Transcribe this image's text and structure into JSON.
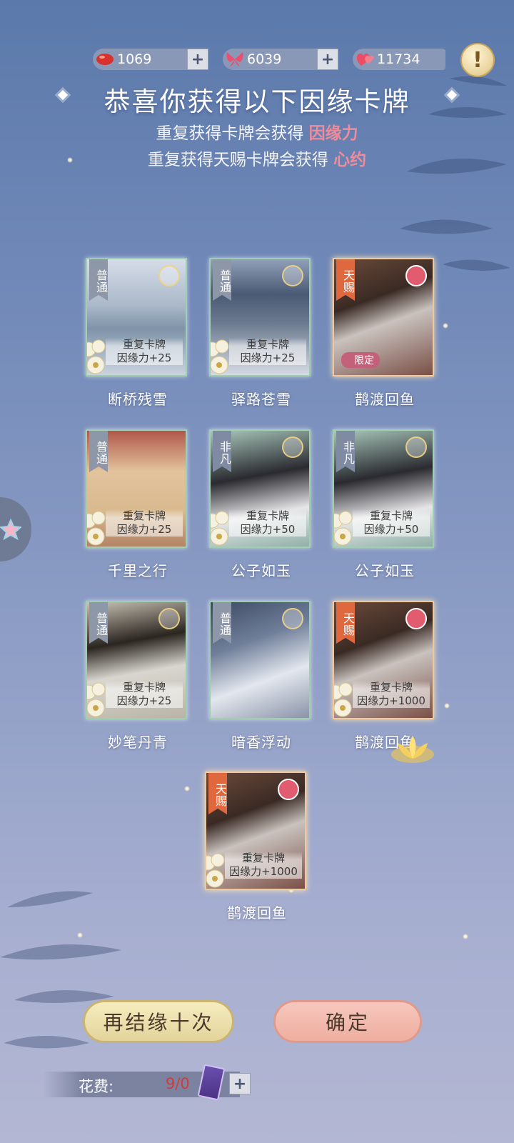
{
  "resources": [
    {
      "name": "red-bean",
      "value": "1069",
      "icon": "red-bean-icon",
      "color": "#d8322e"
    },
    {
      "name": "butterfly",
      "value": "6039",
      "icon": "butterfly-icon",
      "color": "#e94f6f"
    },
    {
      "name": "hearts",
      "value": "11734",
      "icon": "hearts-icon",
      "color": "#ea4d65"
    }
  ],
  "alert_glyph": "!",
  "header": {
    "title": "恭喜你获得以下因缘卡牌",
    "line1_text": "重复获得卡牌会获得",
    "line1_highlight": "因缘力",
    "line2_text": "重复获得天赐卡牌会获得",
    "line2_highlight": "心约"
  },
  "cards": [
    {
      "name": "断桥残雪",
      "rarity": "普通",
      "dup_line1": "重复卡牌",
      "dup_line2": "因缘力+25"
    },
    {
      "name": "驿路苍雪",
      "rarity": "普通",
      "dup_line1": "重复卡牌",
      "dup_line2": "因缘力+25"
    },
    {
      "name": "鹊渡回鱼",
      "rarity": "天赐",
      "badge": "限定"
    },
    {
      "name": "千里之行",
      "rarity": "普通",
      "dup_line1": "重复卡牌",
      "dup_line2": "因缘力+25"
    },
    {
      "name": "公子如玉",
      "rarity": "非凡",
      "dup_line1": "重复卡牌",
      "dup_line2": "因缘力+50"
    },
    {
      "name": "公子如玉",
      "rarity": "非凡",
      "dup_line1": "重复卡牌",
      "dup_line2": "因缘力+50"
    },
    {
      "name": "妙笔丹青",
      "rarity": "普通",
      "dup_line1": "重复卡牌",
      "dup_line2": "因缘力+25"
    },
    {
      "name": "暗香浮动",
      "rarity": "普通"
    },
    {
      "name": "鹊渡回鱼",
      "rarity": "天赐",
      "dup_line1": "重复卡牌",
      "dup_line2": "因缘力+1000"
    },
    {
      "name": "鹊渡回鱼",
      "rarity": "天赐",
      "dup_line1": "重复卡牌",
      "dup_line2": "因缘力+1000"
    }
  ],
  "buttons": {
    "again": "再结缘十次",
    "confirm": "确定"
  },
  "cost": {
    "label": "花费:",
    "value": "9/0",
    "plus": "+"
  },
  "plus_glyph": "+"
}
